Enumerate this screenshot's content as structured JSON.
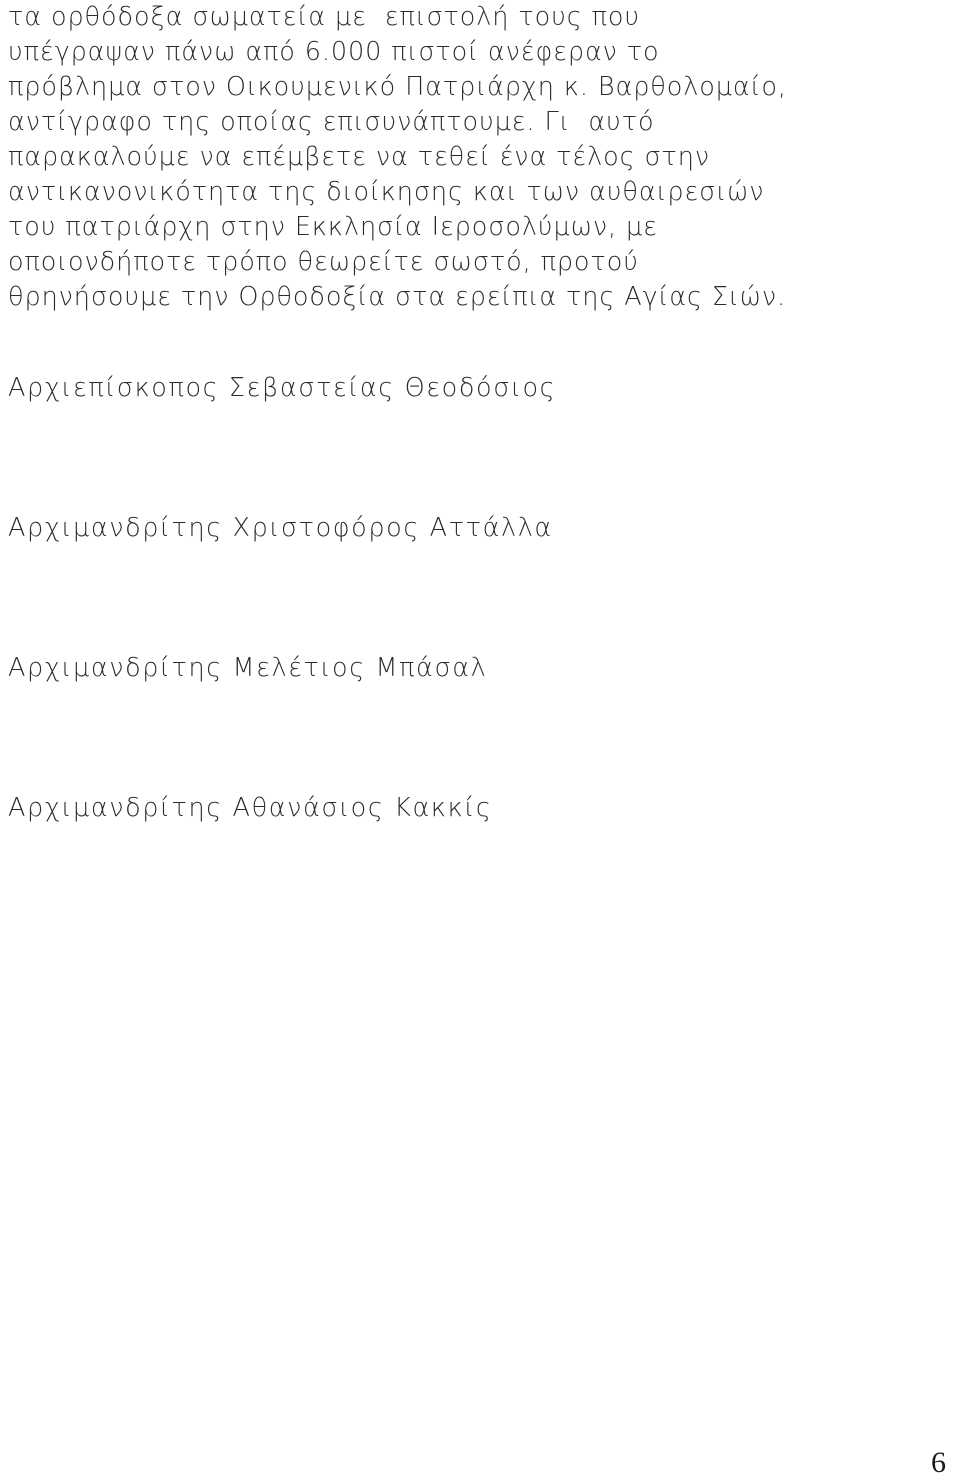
{
  "document": {
    "language": "Greek",
    "page_number": "6",
    "text_color": "#2b2b2b",
    "background_color": "#ffffff"
  },
  "body": {
    "lines": [
      "τα ορθόδοξα σωματεία με  επιστολή τους που",
      "υπέγραψαν πάνω από 6.000 πιστοί ανέφεραν το",
      "πρόβλημα στον Οικουμενικό Πατριάρχη κ. Βαρθολομαίο,",
      "αντίγραφο της οποίας επισυνάπτουμε. Γι  αυτό",
      "παρακαλούμε να επέμβετε να τεθεί ένα τέλος στην",
      "αντικανονικότητα της διοίκησης και των αυθαιρεσιών",
      "του πατριάρχη στην Εκκλησία Ιεροσολύμων, με",
      "οποιονδήποτε τρόπο θεωρείτε σωστό, προτού",
      "θρηνήσουμε την Ορθοδοξία στα ερείπια της Αγίας Σιών."
    ]
  },
  "signatures": {
    "lines": [
      "Αρχιεπίσκοπος Σεβαστείας Θεοδόσιος",
      "Αρχιμανδρίτης Χριστοφόρος Αττάλλα",
      "Αρχιμανδρίτης Μελέτιος Μπάσαλ",
      "Αρχιμανδρίτης Αθανάσιος Κακκίς"
    ]
  },
  "footer": {
    "page_number": "6"
  }
}
